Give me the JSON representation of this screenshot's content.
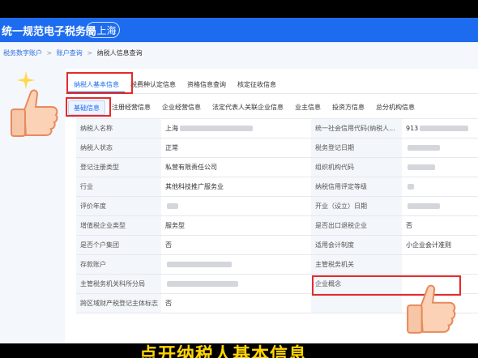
{
  "header": {
    "title": "统一规范电子税务局",
    "region": "上海"
  },
  "breadcrumb": {
    "items": [
      "税务数字账户",
      "账户查询",
      "纳税人信息查询"
    ],
    "separator": ">"
  },
  "tabs_primary": [
    "纳税人基本信息",
    "税费种认定信息",
    "资格信息查询",
    "核定征收信息"
  ],
  "tabs_secondary": [
    "基础信息",
    "注册经营信息",
    "企业经营信息",
    "法定代表人关联企业信息",
    "业主信息",
    "投资方信息",
    "总分机构信息"
  ],
  "table": {
    "rows": [
      {
        "l1": "纳税人名称",
        "v1": "上海",
        "l2": "统一社会信用代码(纳税人...",
        "v2": "913"
      },
      {
        "l1": "纳税人状态",
        "v1": "正常",
        "l2": "税务登记日期",
        "v2": ""
      },
      {
        "l1": "登记注册类型",
        "v1": "私营有限责任公司",
        "l2": "组织机构代码",
        "v2": ""
      },
      {
        "l1": "行业",
        "v1": "其他科技推广服务业",
        "l2": "纳税信用评定等级",
        "v2": ""
      },
      {
        "l1": "评价年度",
        "v1": "",
        "l2": "开业（设立）日期",
        "v2": ""
      },
      {
        "l1": "增值税企业类型",
        "v1": "服务型",
        "l2": "是否出口退税企业",
        "v2": "否"
      },
      {
        "l1": "是否个户集团",
        "v1": "否",
        "l2": "适用会计制度",
        "v2": "小企业会计准则"
      },
      {
        "l1": "存款账户",
        "v1": "",
        "l2": "主管税务机关",
        "v2": ""
      },
      {
        "l1": "主管税务机关科所分局",
        "v1": "",
        "l2": "企业概念",
        "v2": ""
      },
      {
        "l1": "跨区域财产税登记主体标志",
        "v1": "否",
        "l2": "",
        "v2": ""
      }
    ]
  },
  "caption": "点开纳税人基本信息",
  "colors": {
    "brand_blue": "#1d6cf0",
    "highlight_red": "#e52a2a",
    "caption_yellow": "#ffd400"
  },
  "icons": [
    "location-pin-icon",
    "thumbs-up-icon",
    "sparkle-icon"
  ]
}
